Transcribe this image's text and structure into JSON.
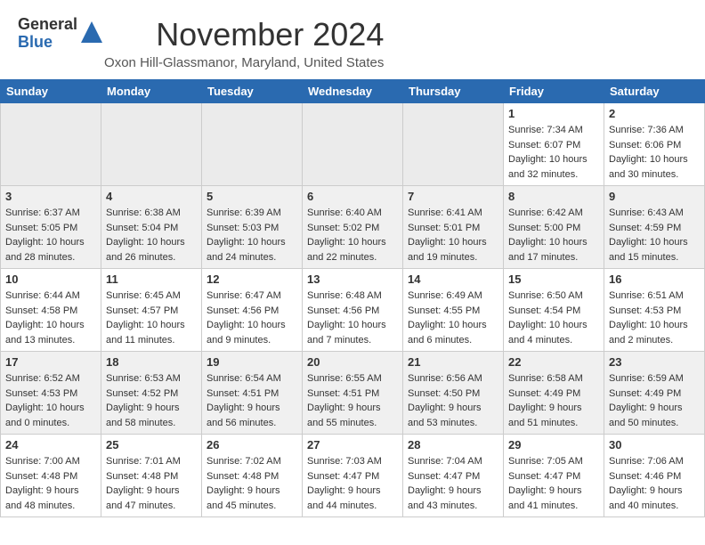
{
  "header": {
    "logo_general": "General",
    "logo_blue": "Blue",
    "month": "November 2024",
    "location": "Oxon Hill-Glassmanor, Maryland, United States"
  },
  "weekdays": [
    "Sunday",
    "Monday",
    "Tuesday",
    "Wednesday",
    "Thursday",
    "Friday",
    "Saturday"
  ],
  "weeks": [
    [
      {
        "day": "",
        "info": ""
      },
      {
        "day": "",
        "info": ""
      },
      {
        "day": "",
        "info": ""
      },
      {
        "day": "",
        "info": ""
      },
      {
        "day": "",
        "info": ""
      },
      {
        "day": "1",
        "info": "Sunrise: 7:34 AM\nSunset: 6:07 PM\nDaylight: 10 hours\nand 32 minutes."
      },
      {
        "day": "2",
        "info": "Sunrise: 7:36 AM\nSunset: 6:06 PM\nDaylight: 10 hours\nand 30 minutes."
      }
    ],
    [
      {
        "day": "3",
        "info": "Sunrise: 6:37 AM\nSunset: 5:05 PM\nDaylight: 10 hours\nand 28 minutes."
      },
      {
        "day": "4",
        "info": "Sunrise: 6:38 AM\nSunset: 5:04 PM\nDaylight: 10 hours\nand 26 minutes."
      },
      {
        "day": "5",
        "info": "Sunrise: 6:39 AM\nSunset: 5:03 PM\nDaylight: 10 hours\nand 24 minutes."
      },
      {
        "day": "6",
        "info": "Sunrise: 6:40 AM\nSunset: 5:02 PM\nDaylight: 10 hours\nand 22 minutes."
      },
      {
        "day": "7",
        "info": "Sunrise: 6:41 AM\nSunset: 5:01 PM\nDaylight: 10 hours\nand 19 minutes."
      },
      {
        "day": "8",
        "info": "Sunrise: 6:42 AM\nSunset: 5:00 PM\nDaylight: 10 hours\nand 17 minutes."
      },
      {
        "day": "9",
        "info": "Sunrise: 6:43 AM\nSunset: 4:59 PM\nDaylight: 10 hours\nand 15 minutes."
      }
    ],
    [
      {
        "day": "10",
        "info": "Sunrise: 6:44 AM\nSunset: 4:58 PM\nDaylight: 10 hours\nand 13 minutes."
      },
      {
        "day": "11",
        "info": "Sunrise: 6:45 AM\nSunset: 4:57 PM\nDaylight: 10 hours\nand 11 minutes."
      },
      {
        "day": "12",
        "info": "Sunrise: 6:47 AM\nSunset: 4:56 PM\nDaylight: 10 hours\nand 9 minutes."
      },
      {
        "day": "13",
        "info": "Sunrise: 6:48 AM\nSunset: 4:56 PM\nDaylight: 10 hours\nand 7 minutes."
      },
      {
        "day": "14",
        "info": "Sunrise: 6:49 AM\nSunset: 4:55 PM\nDaylight: 10 hours\nand 6 minutes."
      },
      {
        "day": "15",
        "info": "Sunrise: 6:50 AM\nSunset: 4:54 PM\nDaylight: 10 hours\nand 4 minutes."
      },
      {
        "day": "16",
        "info": "Sunrise: 6:51 AM\nSunset: 4:53 PM\nDaylight: 10 hours\nand 2 minutes."
      }
    ],
    [
      {
        "day": "17",
        "info": "Sunrise: 6:52 AM\nSunset: 4:53 PM\nDaylight: 10 hours\nand 0 minutes."
      },
      {
        "day": "18",
        "info": "Sunrise: 6:53 AM\nSunset: 4:52 PM\nDaylight: 9 hours\nand 58 minutes."
      },
      {
        "day": "19",
        "info": "Sunrise: 6:54 AM\nSunset: 4:51 PM\nDaylight: 9 hours\nand 56 minutes."
      },
      {
        "day": "20",
        "info": "Sunrise: 6:55 AM\nSunset: 4:51 PM\nDaylight: 9 hours\nand 55 minutes."
      },
      {
        "day": "21",
        "info": "Sunrise: 6:56 AM\nSunset: 4:50 PM\nDaylight: 9 hours\nand 53 minutes."
      },
      {
        "day": "22",
        "info": "Sunrise: 6:58 AM\nSunset: 4:49 PM\nDaylight: 9 hours\nand 51 minutes."
      },
      {
        "day": "23",
        "info": "Sunrise: 6:59 AM\nSunset: 4:49 PM\nDaylight: 9 hours\nand 50 minutes."
      }
    ],
    [
      {
        "day": "24",
        "info": "Sunrise: 7:00 AM\nSunset: 4:48 PM\nDaylight: 9 hours\nand 48 minutes."
      },
      {
        "day": "25",
        "info": "Sunrise: 7:01 AM\nSunset: 4:48 PM\nDaylight: 9 hours\nand 47 minutes."
      },
      {
        "day": "26",
        "info": "Sunrise: 7:02 AM\nSunset: 4:48 PM\nDaylight: 9 hours\nand 45 minutes."
      },
      {
        "day": "27",
        "info": "Sunrise: 7:03 AM\nSunset: 4:47 PM\nDaylight: 9 hours\nand 44 minutes."
      },
      {
        "day": "28",
        "info": "Sunrise: 7:04 AM\nSunset: 4:47 PM\nDaylight: 9 hours\nand 43 minutes."
      },
      {
        "day": "29",
        "info": "Sunrise: 7:05 AM\nSunset: 4:47 PM\nDaylight: 9 hours\nand 41 minutes."
      },
      {
        "day": "30",
        "info": "Sunrise: 7:06 AM\nSunset: 4:46 PM\nDaylight: 9 hours\nand 40 minutes."
      }
    ]
  ]
}
